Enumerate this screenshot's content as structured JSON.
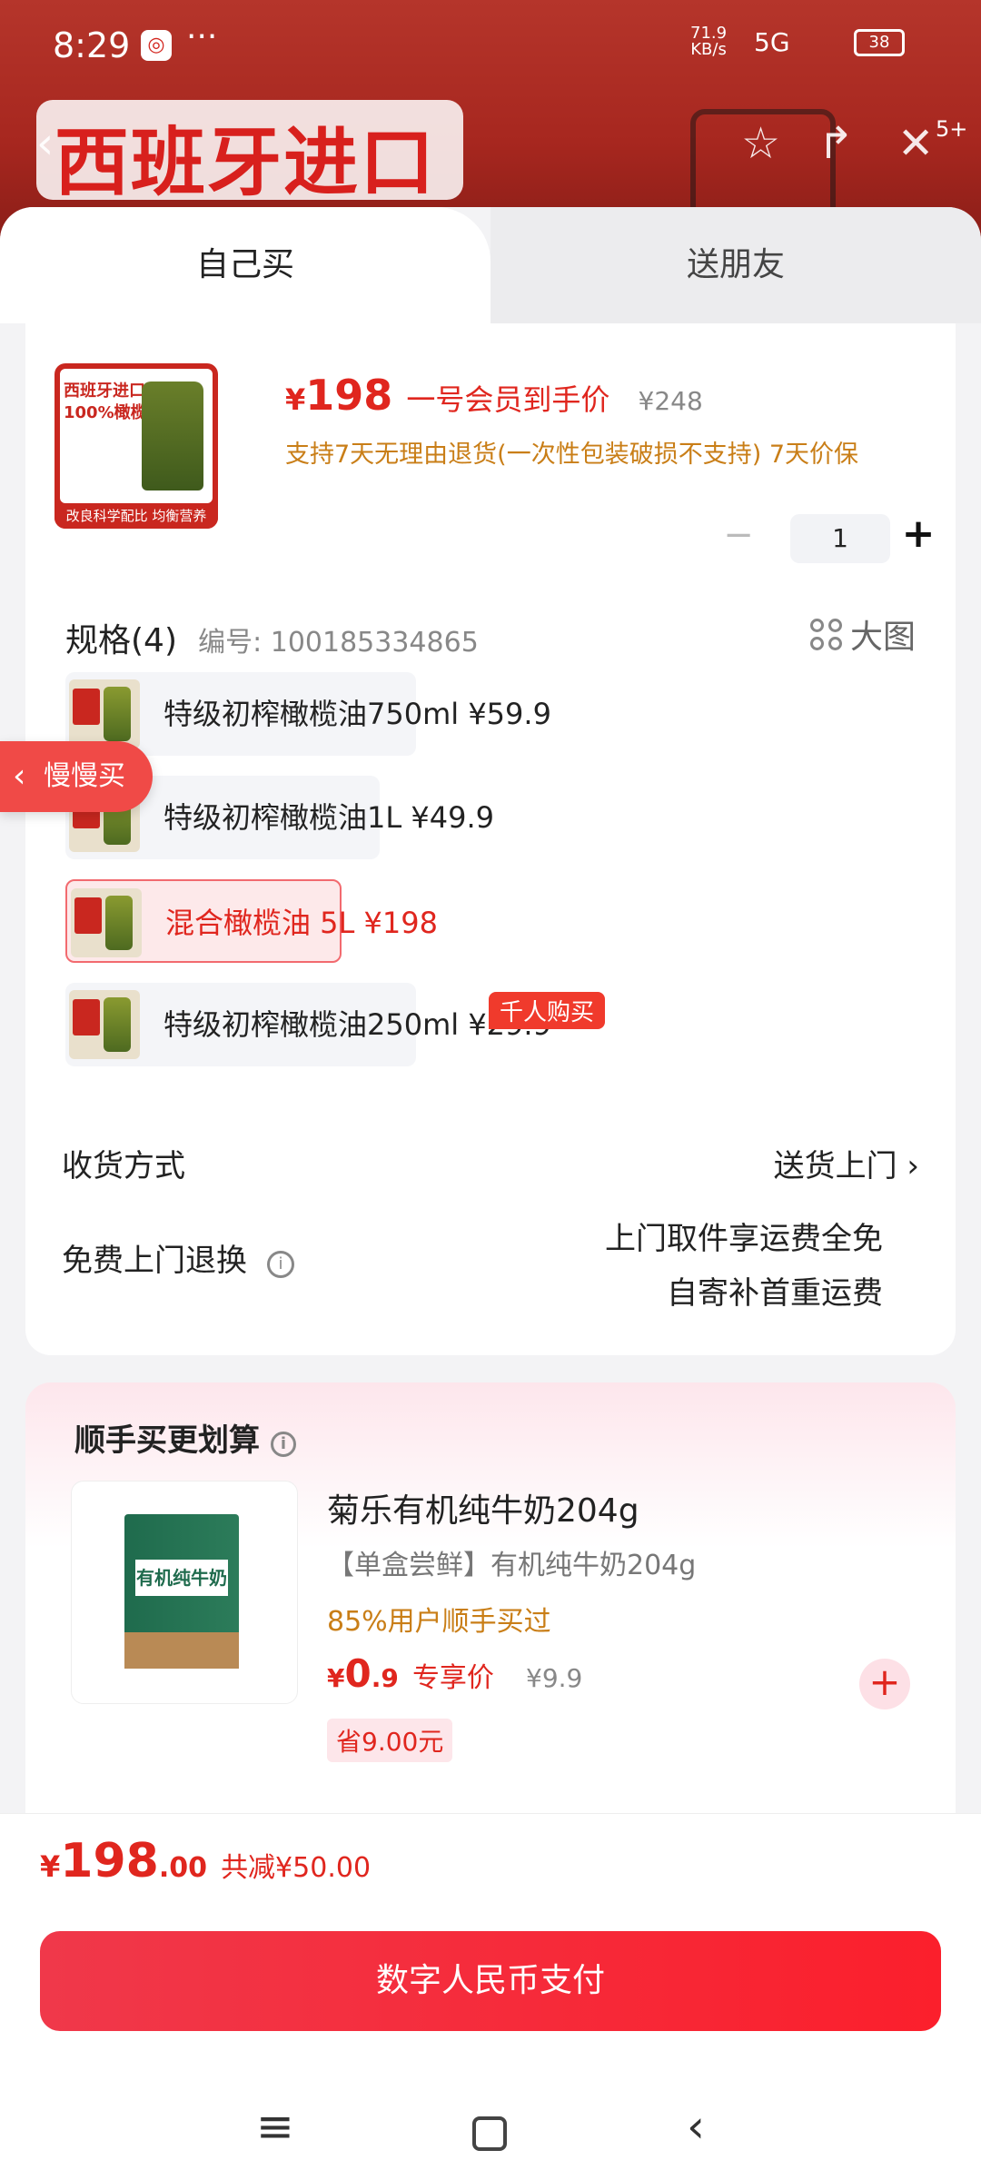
{
  "status_bar": {
    "time": "8:29",
    "app_icon": "bank-app",
    "more": "···",
    "net_speed": "71.9",
    "net_unit": "KB/s",
    "signal": "5G",
    "battery": "38"
  },
  "background": {
    "banner_text": "西班牙进口",
    "cart_badge": "5+"
  },
  "tabs": {
    "self": "自己买",
    "friend": "送朋友"
  },
  "product": {
    "image_title_1": "西班牙进口",
    "image_title_2": "100%橄榄油",
    "image_footer": "改良科学配比 均衡营养",
    "price_yen": "¥",
    "price": "198",
    "price_label": "一号会员到手价",
    "old_price": "¥248",
    "promo": "支持7天无理由退货(一次性包装破损不支持) 7天价保",
    "quantity": "1",
    "minus": "−",
    "plus": "+"
  },
  "spec": {
    "title": "规格(4)",
    "code": "编号: 100185334865",
    "big_image": "大图",
    "options": [
      {
        "label": "特级初榨橄榄油750ml  ¥59.9"
      },
      {
        "label": "特级初榨橄榄油1L  ¥49.9"
      },
      {
        "label": "混合橄榄油 5L  ¥198"
      },
      {
        "label": "特级初榨橄榄油250ml  ¥29.9"
      }
    ],
    "hot_tag": "千人购买"
  },
  "float_button": {
    "label": "慢慢买",
    "chevron": "‹"
  },
  "delivery": {
    "label": "收货方式",
    "value": "送货上门",
    "chevron": "›"
  },
  "returns": {
    "label": "免费上门退换",
    "info": "i",
    "line1": "上门取件享运费全免",
    "line2": "自寄补首重运费"
  },
  "recommend": {
    "title": "顺手买更划算",
    "info": "i",
    "box_label": "有机纯牛奶",
    "name": "菊乐有机纯牛奶204g",
    "subtitle": "【单盒尝鲜】有机纯牛奶204g",
    "buy_rate": "85%用户顺手买过",
    "price_yen": "¥",
    "price_int": "0",
    "price_dec": ".9",
    "price_label": "专享价",
    "old_price": "¥9.9",
    "save": "省9.00元",
    "add": "+"
  },
  "total": {
    "yen": "¥",
    "amount": "198",
    "decimal": ".00",
    "discount": "共减¥50.00"
  },
  "pay_button": "数字人民币支付",
  "system_nav": {
    "menu": "≡",
    "back": "‹"
  },
  "colors": {
    "accent": "#e0261e",
    "promo_orange": "#c97e17",
    "pay_button": "#f5283a"
  }
}
